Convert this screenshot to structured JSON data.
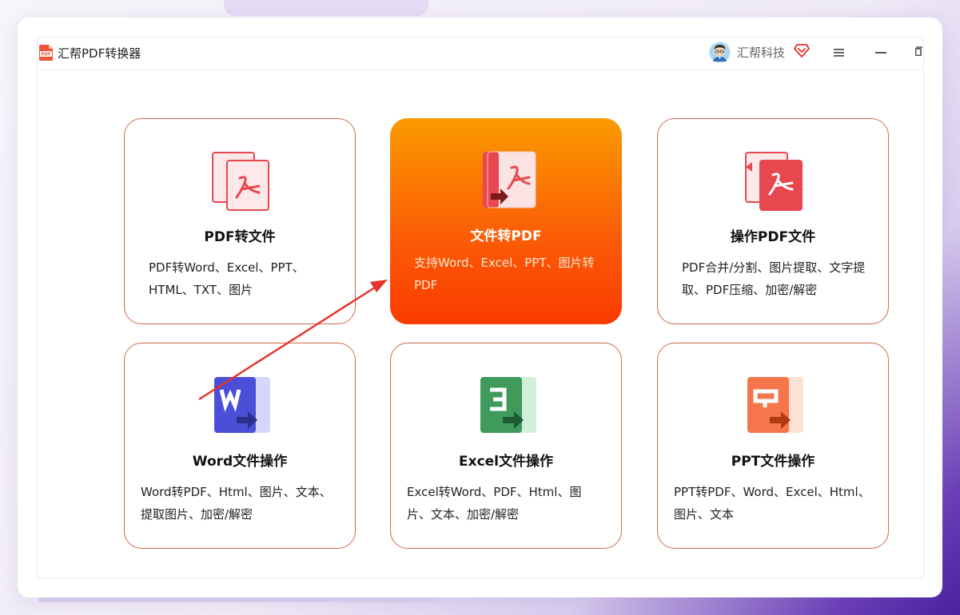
{
  "app": {
    "title": "汇帮PDF转换器"
  },
  "user": {
    "name": "汇帮科技"
  },
  "cards": [
    {
      "title": "PDF转文件",
      "desc": "PDF转Word、Excel、PPT、HTML、TXT、图片"
    },
    {
      "title": "文件转PDF",
      "desc": "支持Word、Excel、PPT、图片转PDF"
    },
    {
      "title": "操作PDF文件",
      "desc": "PDF合并/分割、图片提取、文字提取、PDF压缩、加密/解密"
    },
    {
      "title": "Word文件操作",
      "desc": "Word转PDF、Html、图片、文本、提取图片、加密/解密"
    },
    {
      "title": "Excel文件操作",
      "desc": "Excel转Word、PDF、Html、图片、文本、加密/解密"
    },
    {
      "title": "PPT文件操作",
      "desc": "PPT转PDF、Word、Excel、Html、图片、文本"
    }
  ],
  "colors": {
    "accent_orange": "#fb5a06",
    "card_border": "#cf6a4e",
    "pdf_red": "#e8474f",
    "word_blue": "#4b4fd8",
    "excel_green": "#3f9a5b",
    "ppt_orange": "#f4764a",
    "annotation_arrow": "#e8312c"
  },
  "icons": {
    "app_logo": "pdf-logo-icon",
    "avatar": "user-avatar",
    "vip": "vip-diamond-icon",
    "menu": "hamburger-menu-icon",
    "minimize": "minimize-icon",
    "maximize": "maximize-icon"
  }
}
